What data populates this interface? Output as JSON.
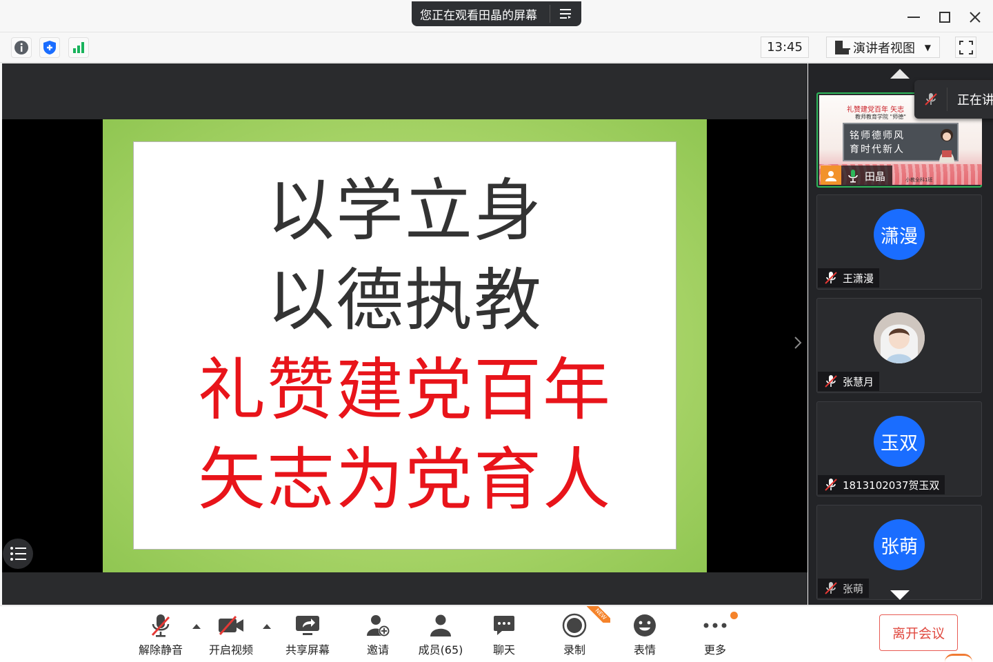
{
  "titlebar": {
    "share_status": "您正在观看田晶的屏幕",
    "share_menu_icon": "list-menu-icon"
  },
  "toolbar": {
    "time": "13:45",
    "view_mode": "演讲者视图"
  },
  "slide": {
    "line1": "以学立身",
    "line2": "以德执教",
    "line3": "礼赞建党百年",
    "line4": "矢志为党育人"
  },
  "participants": {
    "speaking_tip": "正在讲",
    "active": {
      "name": "田晶",
      "thumb_title": "礼赞建党百年  矢志",
      "thumb_subtitle": "教师教育学院 \"师德\"",
      "board_line1": "铭师德师风",
      "board_line2": "育时代新人",
      "thumb_footer": "小教全科1班"
    },
    "tiles": [
      {
        "avatar_text": "潇漫",
        "name": "王潇漫",
        "type": "circle"
      },
      {
        "avatar_text": "",
        "name": "张慧月",
        "type": "photo"
      },
      {
        "avatar_text": "玉双",
        "name": "1813102037贺玉双",
        "type": "circle"
      },
      {
        "avatar_text": "张萌",
        "name": "张萌",
        "type": "circle"
      }
    ]
  },
  "bottombar": {
    "unmute": "解除静音",
    "start_video": "开启视频",
    "share_screen": "共享屏幕",
    "invite": "邀请",
    "members": "成员(65)",
    "chat": "聊天",
    "record": "录制",
    "new_badge": "NEW",
    "emoji": "表情",
    "more": "更多",
    "leave": "离开会议"
  },
  "colors": {
    "accent_blue": "#1a6dff",
    "leave_red": "#e04a40",
    "active_green": "#2db75a",
    "slide_red": "#e8141a",
    "badge_orange": "#f5832a"
  }
}
